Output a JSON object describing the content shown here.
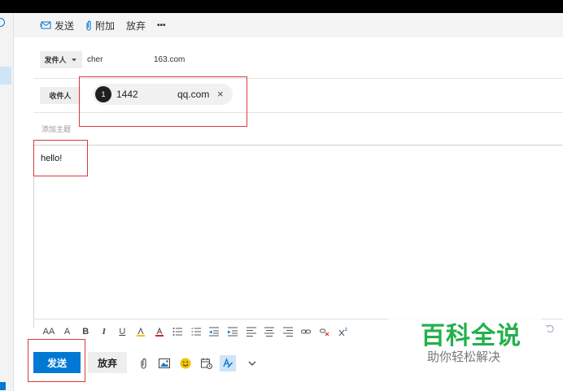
{
  "toolbar": {
    "send": "发送",
    "attach": "附加",
    "discard": "放弃",
    "more": "•••"
  },
  "from": {
    "label": "发件人",
    "value": "cher",
    "domain": "163.com"
  },
  "to": {
    "label": "收件人",
    "avatar": "1",
    "name": "1442",
    "domain": "qq.com",
    "remove": "×"
  },
  "subject": {
    "placeholder": "添加主题"
  },
  "body": {
    "text": "hello!"
  },
  "format_icons": [
    "font-size-icon",
    "grow-font-icon",
    "bold-icon",
    "italic-icon",
    "underline-icon",
    "highlight-icon",
    "font-color-icon",
    "bullets-icon",
    "numbering-icon",
    "outdent-icon",
    "indent-icon",
    "align-left-icon",
    "align-center-icon",
    "align-right-icon",
    "link-icon",
    "unlink-icon",
    "superscript-icon"
  ],
  "format_glyphs": {
    "font_size": "AA",
    "grow": "A",
    "bold": "B",
    "italic": "I",
    "underline": "U"
  },
  "bottom": {
    "send": "发送",
    "discard": "放弃"
  },
  "watermark": {
    "line1": "百科全说",
    "line2": "助你轻松解决"
  },
  "colors": {
    "accent": "#0078d4",
    "highlight_box": "#d93a3a",
    "watermark": "#22b14c"
  }
}
